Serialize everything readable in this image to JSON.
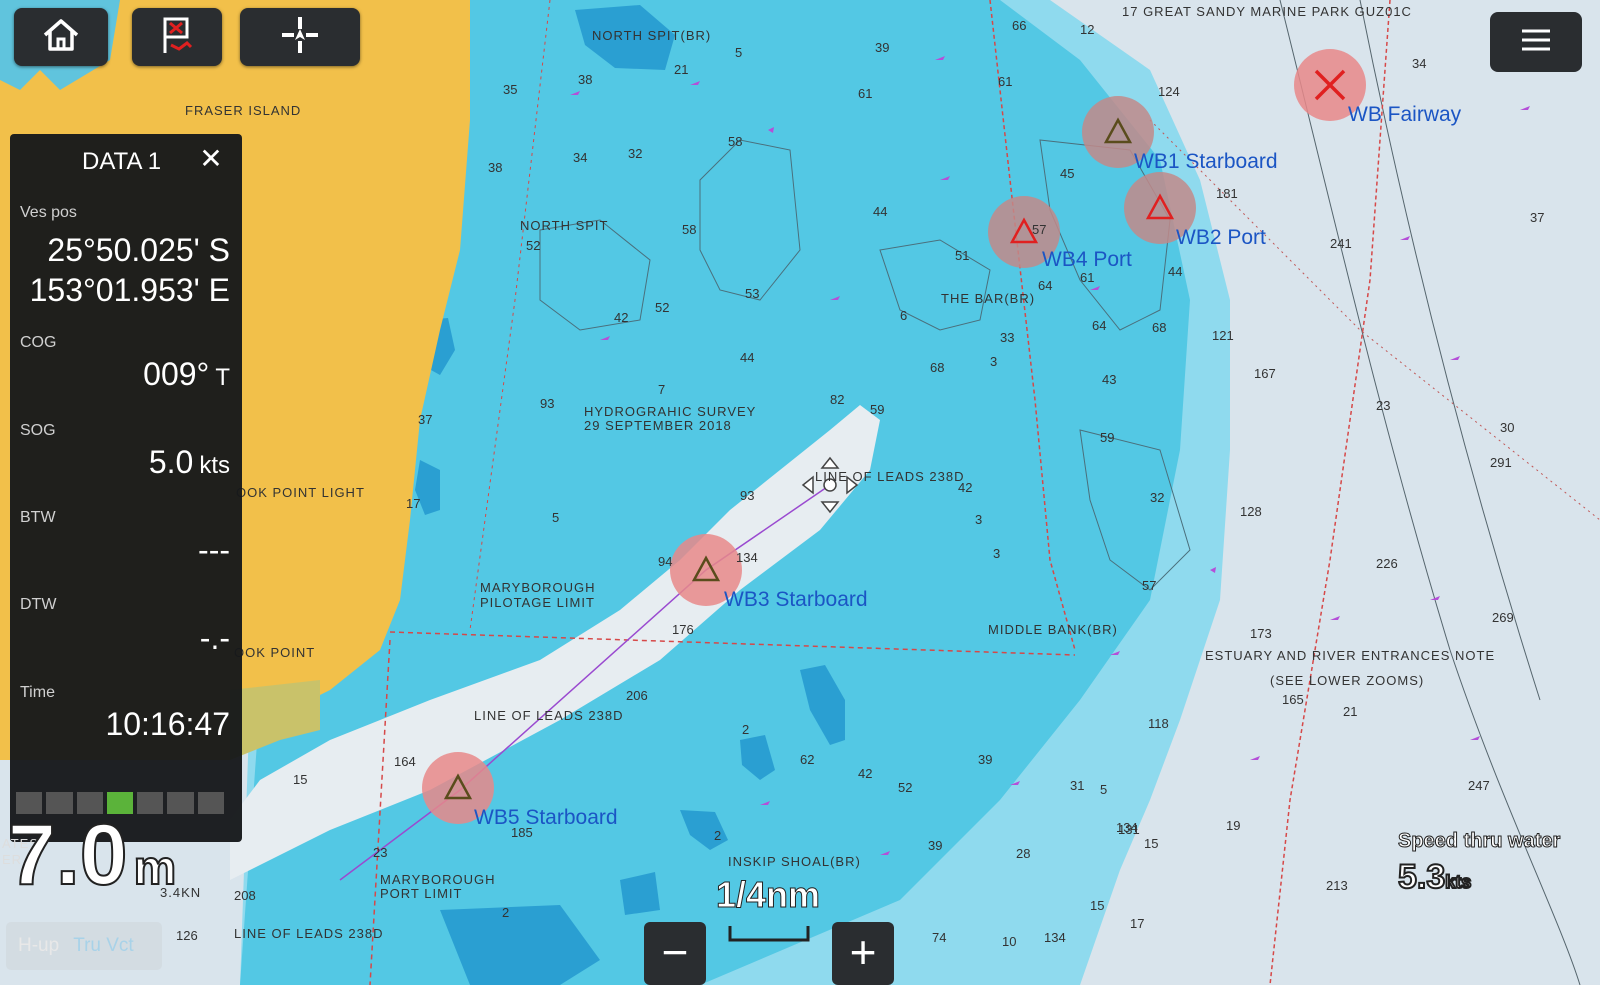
{
  "toolbar": {
    "home_icon": "home-icon",
    "mob_icon": "man-overboard-icon",
    "target_icon": "crosshair-icon",
    "menu_icon": "hamburger-menu-icon"
  },
  "chart_labels": {
    "park": "17 GREAT SANDY MARINE PARK GUZ01C",
    "fraser_island": "FRASER ISLAND",
    "north_spit_br": "NORTH SPIT(BR)",
    "north_spit": "NORTH SPIT",
    "hydro_1": "HYDROGRAHIC SURVEY",
    "hydro_2": "29 SEPTEMBER 2018",
    "line_of_leads_1": "LINE OF LEADS 238D",
    "line_of_leads_2": "LINE OF LEADS 238D",
    "line_of_leads_3": "LINE OF LEADS 238D",
    "the_bar": "THE BAR(BR)",
    "hook_point_light": "OOK POINT LIGHT",
    "hook_point": "OOK POINT",
    "maryborough_pilotage_1": "MARYBOROUGH",
    "maryborough_pilotage_2": "PILOTAGE LIMIT",
    "maryborough_port_1": "MARYBOROUGH",
    "maryborough_port_2": "PORT LIMIT",
    "middle_bank": "MIDDLE BANK(BR)",
    "estuary_1": "ESTUARY AND RIVER ENTRANCES NOTE",
    "estuary_2": "(SEE LOWER ZOOMS)",
    "inskip": "INSKIP SHOAL(BR)",
    "tide_kn": "3.4KN"
  },
  "waypoints": {
    "wb_fairway": "WB Fairway",
    "wb1_starboard": "WB1 Starboard",
    "wb2_port": "WB2 Port",
    "wb4_port": "WB4 Port",
    "wb3_starboard": "WB3 Starboard",
    "wb5_starboard": "WB5 Starboard"
  },
  "data_panel": {
    "title": "DATA 1",
    "close_icon": "close-icon",
    "ves_pos_label": "Ves pos",
    "latitude": "25°50.025' S",
    "longitude": "153°01.953' E",
    "cog_label": "COG",
    "cog_value": "009°",
    "cog_unit": "T",
    "sog_label": "SOG",
    "sog_value": "5.0",
    "sog_unit": "kts",
    "btw_label": "BTW",
    "btw_value": "---",
    "dtw_label": "DTW",
    "dtw_value": "-.-",
    "time_label": "Time",
    "time_value": "10:16:47"
  },
  "overlay": {
    "depth_value": "7.0",
    "depth_unit": "m",
    "speed_label": "Speed thru water",
    "speed_value": "5.3",
    "speed_unit": "kts",
    "scale": "1/4nm",
    "mode_h_up": "H-up",
    "mode_tru_vct": "Tru Vct",
    "zoom_out": "−",
    "zoom_in": "+",
    "left_partial_1": "ATES",
    "left_partial_2": "ER"
  },
  "depths": [
    "5",
    "38",
    "21",
    "39",
    "61",
    "66",
    "12",
    "124",
    "34",
    "35",
    "61",
    "58",
    "34",
    "32",
    "38",
    "52",
    "44",
    "58",
    "57",
    "45",
    "181",
    "37",
    "241",
    "51",
    "61",
    "64",
    "44",
    "52",
    "42",
    "53",
    "64",
    "6",
    "68",
    "121",
    "33",
    "3",
    "44",
    "68",
    "82",
    "59",
    "167",
    "7",
    "37",
    "93",
    "43",
    "59",
    "23",
    "30",
    "291",
    "42",
    "128",
    "3",
    "32",
    "5",
    "93",
    "134",
    "3",
    "57",
    "226",
    "94",
    "17",
    "176",
    "173",
    "269",
    "206",
    "165",
    "164",
    "118",
    "21",
    "134",
    "2",
    "62",
    "42",
    "52",
    "39",
    "31",
    "5",
    "247",
    "15",
    "185",
    "23",
    "131",
    "15",
    "19",
    "2",
    "28",
    "39",
    "213",
    "74",
    "208",
    "126",
    "2",
    "10",
    "134",
    "17",
    "15"
  ],
  "colors": {
    "deep_water": "#dde7ef",
    "mid_water": "#8dddf0",
    "shallow_water": "#3fc2e0",
    "shoal": "#2a9ad0",
    "land": "#f3c24a",
    "waypoint_text": "#1b55c4",
    "danger": "#e83a3a"
  }
}
